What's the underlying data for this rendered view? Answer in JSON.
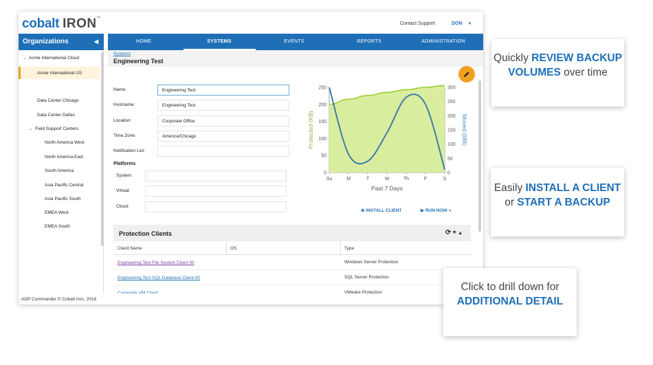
{
  "app": {
    "logo_brand": "cobalt",
    "logo_iron": "IRON",
    "logo_tm": "™",
    "contact_support": "Contact Support",
    "user": "DON",
    "footer": "ADP Commander © Cobalt Iron, 2018"
  },
  "sidebar": {
    "title": "Organizations",
    "collapse_glyph": "◀",
    "items": [
      {
        "label": "Acme International Cloud",
        "caret": "⌄"
      },
      {
        "label": "Acme International US"
      },
      {
        "label": "Data Center Chicago"
      },
      {
        "label": "Data Center Dallas"
      },
      {
        "label": "Field Support Centers",
        "caret": "⌄"
      },
      {
        "label": "North America West"
      },
      {
        "label": "North America East"
      },
      {
        "label": "South America"
      },
      {
        "label": "Asia Pacific Central"
      },
      {
        "label": "Asia Pacific South"
      },
      {
        "label": "EMEA West"
      },
      {
        "label": "EMEA South"
      }
    ]
  },
  "nav": {
    "items": [
      "HOME",
      "SYSTEMS",
      "EVENTS",
      "REPORTS",
      "ADMINISTRATION"
    ],
    "active": "SYSTEMS"
  },
  "page": {
    "breadcrumb": "Systems",
    "title": "Engineering Test"
  },
  "form": {
    "name_label": "Name:",
    "name_value": "Engineering Test",
    "hostname_label": "Hostname:",
    "hostname_value": "Engineering Test",
    "location_label": "Location:",
    "location_value": "Corporate Office",
    "timezone_label": "Time Zone:",
    "timezone_value": "America/Chicago",
    "notification_label": "Notification List:",
    "notification_value": "",
    "platforms_title": "Platforms",
    "system_label": "System:",
    "virtual_label": "Virtual:",
    "cloud_label": "Cloud:"
  },
  "actions": {
    "install_client": "INSTALL CLIENT",
    "run_now": "RUN NOW"
  },
  "chart_data": {
    "type": "line",
    "categories": [
      "Su",
      "M",
      "T",
      "W",
      "Th",
      "F",
      "S"
    ],
    "xlabel": "Past 7 Days",
    "ylabel_left": "Protected (KB)",
    "ylabel_right": "Moved (MB)",
    "ylim_left": [
      0,
      250
    ],
    "yticks_left": [
      0,
      50,
      100,
      150,
      200,
      250
    ],
    "ylim_right": [
      0,
      300
    ],
    "yticks_right": [
      0,
      50,
      100,
      150,
      200,
      250,
      300
    ],
    "series": [
      {
        "name": "Protected (KB)",
        "axis": "left",
        "style": "area",
        "color": "#9acd32",
        "values": [
          200,
          215,
          226,
          235,
          243,
          250,
          255
        ]
      },
      {
        "name": "Moved (MB)",
        "axis": "right",
        "style": "line",
        "color": "#3d7ea6",
        "values": [
          300,
          65,
          40,
          140,
          265,
          240,
          10
        ]
      }
    ]
  },
  "clients": {
    "title": "Protection Clients",
    "tools": [
      "⟳",
      "+",
      "▲"
    ],
    "columns": [
      "Client Name",
      "OS",
      "Type"
    ],
    "rows": [
      {
        "name": "Engineering Test File System Client 00",
        "os": "",
        "type": "Windows Server Protection"
      },
      {
        "name": "Engineering Test SQL Database Client 00",
        "os": "",
        "type": "SQL Server Protection"
      },
      {
        "name": "Corporate VM Client",
        "os": "",
        "type": "VMware Protection"
      }
    ]
  },
  "callouts": {
    "review": {
      "pre": "Quickly ",
      "hl": "REVIEW BACKUP VOLUMES",
      "post": " over time"
    },
    "install": {
      "pre": "Easily ",
      "hl1": "INSTALL A CLIENT",
      "mid": " or ",
      "hl2": "START A BACKUP"
    },
    "drill": {
      "pre": "Click to drill down for ",
      "hl": "ADDITIONAL DETAIL"
    }
  },
  "colors": {
    "brand": "#1f6fb7",
    "accent": "#f0a020",
    "area": "#9acd32",
    "line": "#3d7ea6"
  }
}
